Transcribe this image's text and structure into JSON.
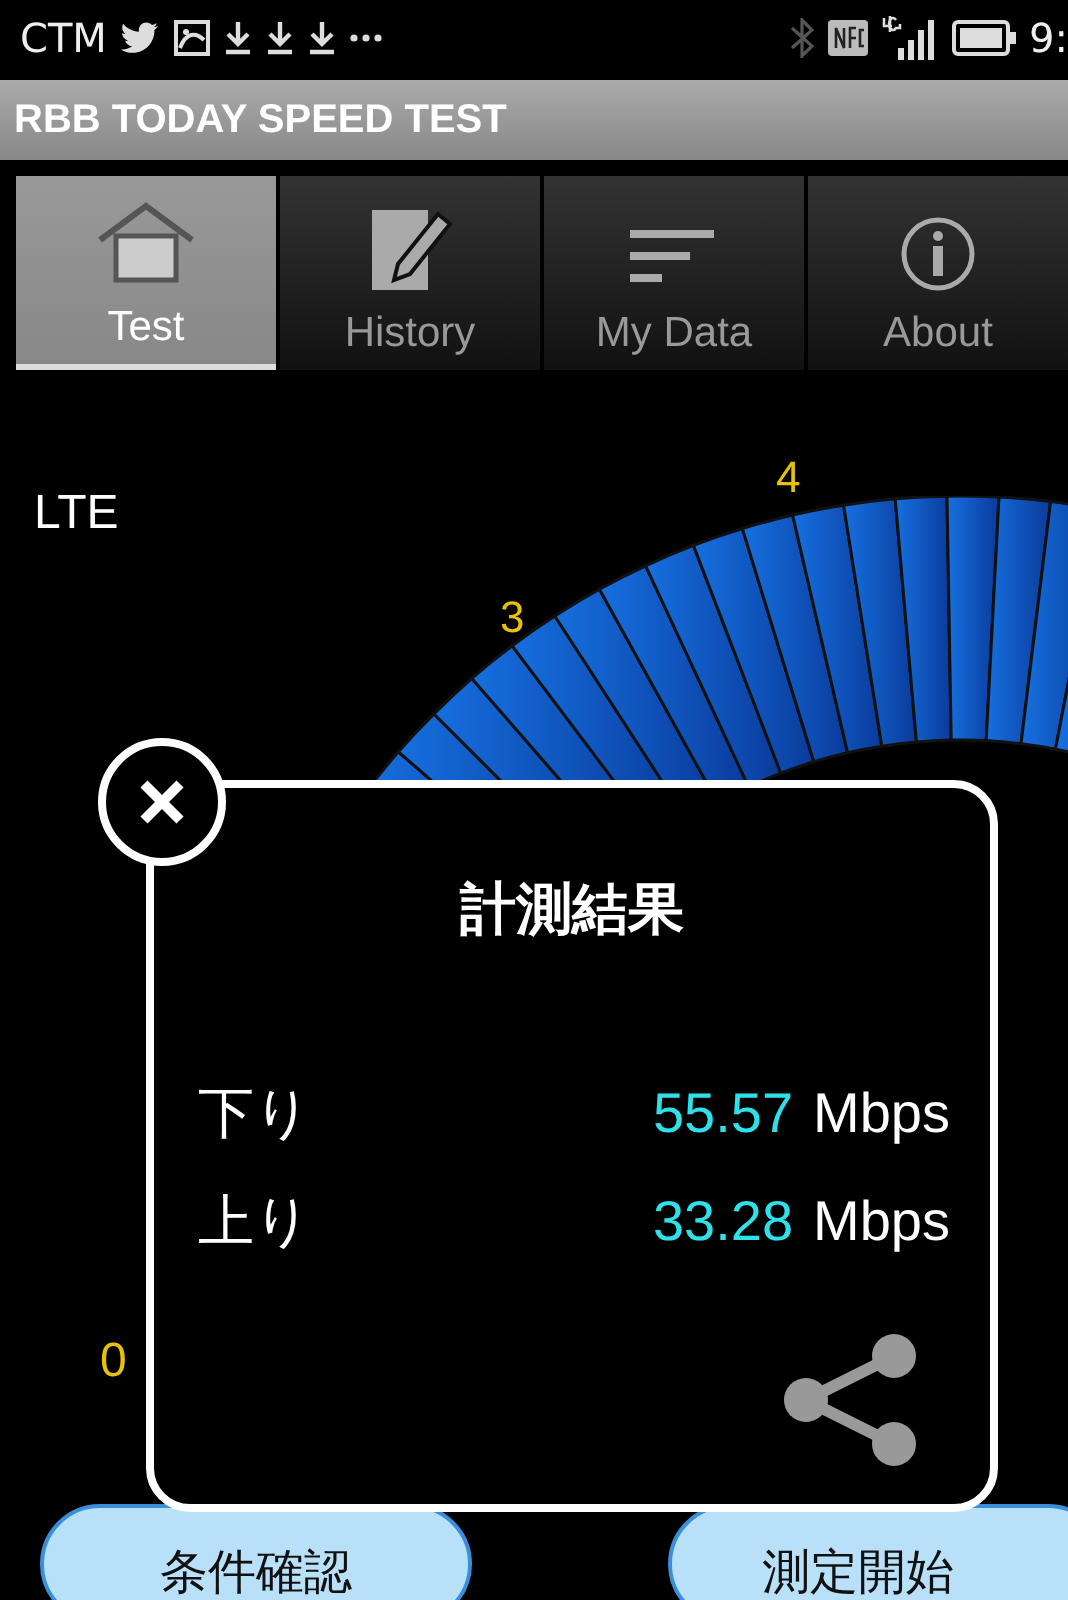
{
  "status_bar": {
    "carrier": "CTM",
    "time": "9:"
  },
  "app_title": "RBB TODAY SPEED TEST",
  "tabs": [
    {
      "label": "Test",
      "selected": true
    },
    {
      "label": "History",
      "selected": false
    },
    {
      "label": "My Data",
      "selected": false
    },
    {
      "label": "About",
      "selected": false
    }
  ],
  "network": "LTE",
  "gauge": {
    "ticks": [
      "3",
      "4"
    ],
    "zero_label": "0"
  },
  "dialog": {
    "title": "計測結果",
    "rows": [
      {
        "label": "下り",
        "value": "55.57",
        "unit": "Mbps"
      },
      {
        "label": "上り",
        "value": "33.28",
        "unit": "Mbps"
      }
    ]
  },
  "buttons": [
    "条件確認",
    "測定開始"
  ]
}
